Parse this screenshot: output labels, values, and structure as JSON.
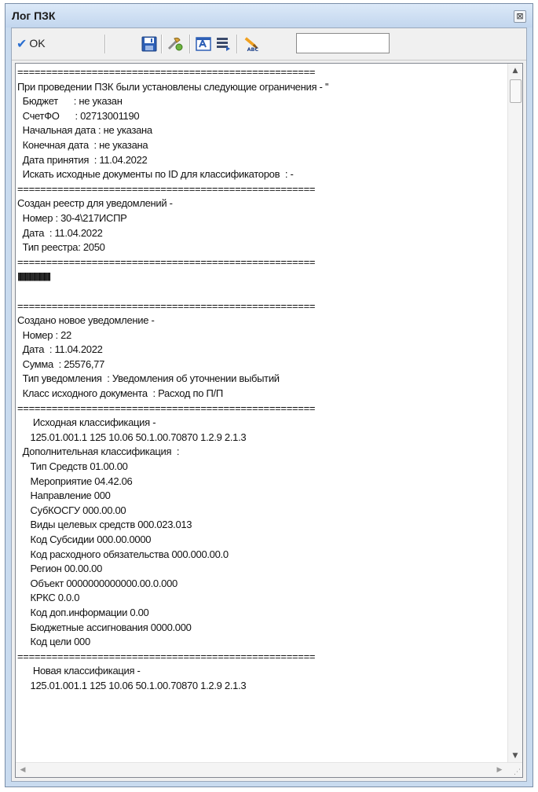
{
  "window": {
    "title": "Лог ПЗК",
    "close_symbol": "⊠"
  },
  "toolbar": {
    "ok_label": "OK",
    "search_value": "",
    "icons": [
      "save-icon",
      "tools-icon",
      "report-icon",
      "list-icon",
      "spellcheck-icon"
    ]
  },
  "log": {
    "lines": [
      "====================================================",
      "При проведении ПЗК были установлены следующие ограничения - ''",
      "  Бюджет      : не указан",
      "  СчетФО      : 02713001190",
      "  Начальная дата : не указана",
      "  Конечная дата  : не указана",
      "  Дата принятия  : 11.04.2022",
      "  Искать исходные документы по ID для классификаторов  : -",
      "====================================================",
      "Создан реестр для уведомлений -",
      "  Номер : 30-4\\217ИСПР",
      "  Дата  : 11.04.2022",
      "  Тип реестра: 2050",
      "====================================================",
      "||||||||||||||||||||||||||||||||||||||||||||||||",
      "",
      "====================================================",
      "Создано новое уведомление -",
      "  Номер : 22",
      "  Дата  : 11.04.2022",
      "  Сумма  : 25576,77",
      "  Тип уведомления  : Уведомления об уточнении выбытий",
      "  Класс исходного документа  : Расход по П/П",
      "====================================================",
      "      Исходная классификация -",
      "     125.01.001.1 125 10.06 50.1.00.70870 1.2.9 2.1.3",
      "  Дополнительная классификация  :",
      "     Тип Средств 01.00.00",
      "     Мероприятие 04.42.06",
      "     Направление 000",
      "     СубКОСГУ 000.00.00",
      "     Виды целевых средств 000.023.013",
      "     Код Субсидии 000.00.0000",
      "     Код расходного обязательства 000.000.00.0",
      "     Регион 00.00.00",
      "     Объект 0000000000000.00.0.000",
      "     КРКС 0.0.0",
      "     Код доп.информации 0.00",
      "     Бюджетные ассигнования 0000.000",
      "     Код цели 000",
      "====================================================",
      "      Новая классификация -",
      "     125.01.001.1 125 10.06 50.1.00.70870 1.2.9 2.1.3"
    ]
  }
}
